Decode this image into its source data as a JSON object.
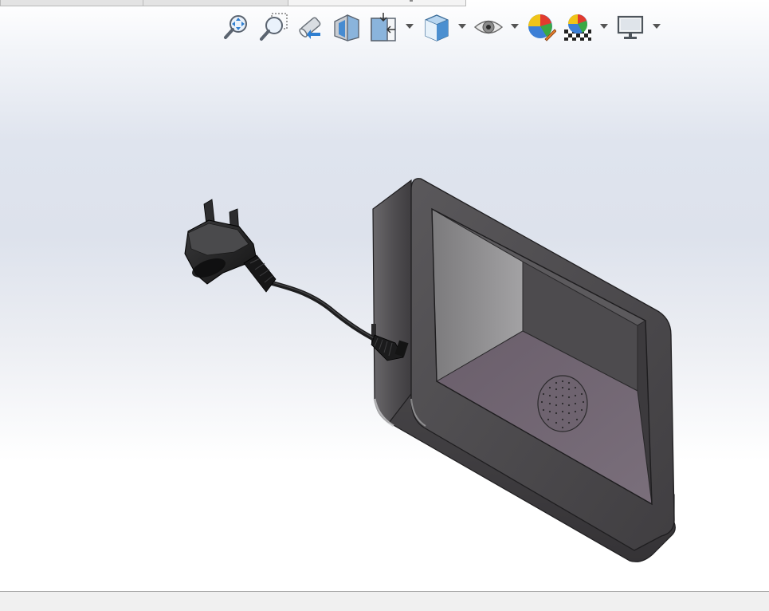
{
  "window": {
    "type": "3D CAD graphics area",
    "background_top": "#ffffff",
    "background_mid": "#dde2ec"
  },
  "document_tabs": [
    {
      "label": "",
      "active": false
    },
    {
      "label": "",
      "active": false
    },
    {
      "label": "",
      "active": true
    }
  ],
  "view_toolbar": {
    "tools": [
      {
        "icon": "zoom-to-fit-icon",
        "has_dropdown": false
      },
      {
        "icon": "zoom-to-area-icon",
        "has_dropdown": false
      },
      {
        "icon": "previous-view-icon",
        "has_dropdown": false
      },
      {
        "icon": "section-view-icon",
        "has_dropdown": false
      },
      {
        "icon": "view-orientation-icon",
        "has_dropdown": true
      },
      {
        "icon": "display-style-icon",
        "has_dropdown": true
      },
      {
        "icon": "hide-show-items-icon",
        "has_dropdown": true
      },
      {
        "icon": "edit-appearance-icon",
        "has_dropdown": false
      },
      {
        "icon": "apply-scene-icon",
        "has_dropdown": true
      },
      {
        "icon": "view-settings-icon",
        "has_dropdown": true
      }
    ]
  },
  "model": {
    "description": "",
    "body_color": "#4a474a",
    "screen_color": "#6f6470"
  },
  "status_bar": {
    "text": ""
  }
}
